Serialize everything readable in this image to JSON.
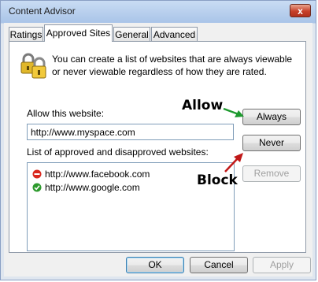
{
  "window": {
    "title": "Content Advisor",
    "close_glyph": "x"
  },
  "tabs": [
    {
      "label": "Ratings",
      "active": false
    },
    {
      "label": "Approved Sites",
      "active": true
    },
    {
      "label": "General",
      "active": false
    },
    {
      "label": "Advanced",
      "active": false
    }
  ],
  "description": "You can create a list of websites that are always viewable or never viewable regardless of how they are rated.",
  "allow_label": "Allow this website:",
  "website_input": {
    "value": "http://www.myspace.com"
  },
  "list_label": "List of approved and disapproved websites:",
  "sites": [
    {
      "url": "http://www.facebook.com",
      "status": "never",
      "icon": "blocked-icon"
    },
    {
      "url": "http://www.google.com",
      "status": "always",
      "icon": "approved-icon"
    }
  ],
  "buttons": {
    "always": "Always",
    "never": "Never",
    "remove": "Remove"
  },
  "footer": {
    "ok": "OK",
    "cancel": "Cancel",
    "apply": "Apply"
  },
  "annotations": {
    "allow": "Allow",
    "block": "Block"
  },
  "colors": {
    "annotation_arrow_allow": "#1e9a2f",
    "annotation_arrow_block": "#c01818",
    "blocked": "#d9281e",
    "approved": "#2d9a2d"
  }
}
